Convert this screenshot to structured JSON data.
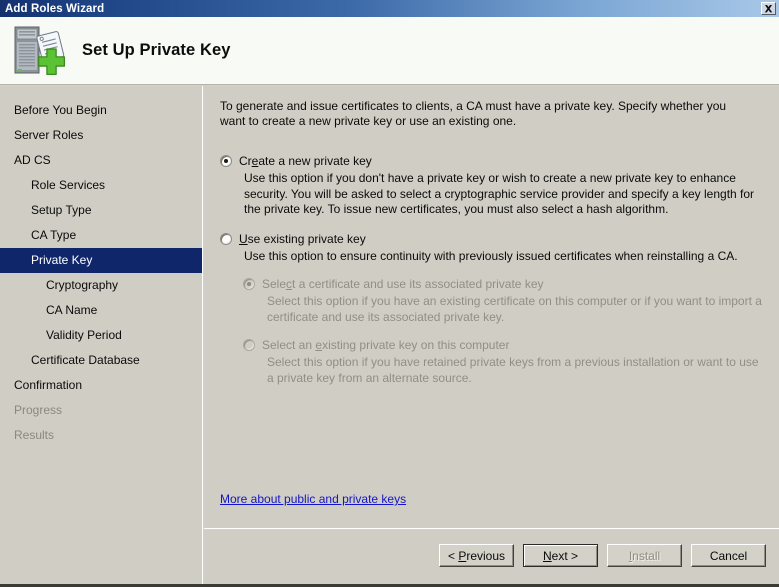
{
  "window": {
    "title": "Add Roles Wizard",
    "close_label": "Close",
    "close_icon": "close-icon"
  },
  "header": {
    "title": "Set Up Private Key",
    "icon": "server-certificate-add-icon"
  },
  "sidebar": {
    "items": [
      {
        "label": "Before You Begin",
        "level": 0,
        "state": "normal"
      },
      {
        "label": "Server Roles",
        "level": 0,
        "state": "normal"
      },
      {
        "label": "AD CS",
        "level": 0,
        "state": "normal"
      },
      {
        "label": "Role Services",
        "level": 1,
        "state": "normal"
      },
      {
        "label": "Setup Type",
        "level": 1,
        "state": "normal"
      },
      {
        "label": "CA Type",
        "level": 1,
        "state": "normal"
      },
      {
        "label": "Private Key",
        "level": 1,
        "state": "selected"
      },
      {
        "label": "Cryptography",
        "level": 2,
        "state": "normal"
      },
      {
        "label": "CA Name",
        "level": 2,
        "state": "normal"
      },
      {
        "label": "Validity Period",
        "level": 2,
        "state": "normal"
      },
      {
        "label": "Certificate Database",
        "level": 1,
        "state": "normal"
      },
      {
        "label": "Confirmation",
        "level": 0,
        "state": "normal"
      },
      {
        "label": "Progress",
        "level": 0,
        "state": "disabled"
      },
      {
        "label": "Results",
        "level": 0,
        "state": "disabled"
      }
    ]
  },
  "content": {
    "intro": "To generate and issue certificates to clients, a CA must have a private key. Specify whether you want to create a new private key or use an existing one.",
    "options": [
      {
        "label_pre": "Cr",
        "label_accel": "e",
        "label_post": "ate a new private key",
        "checked": true,
        "disabled": false,
        "description": "Use this option if you don't have a private key or wish to create a new private key to enhance security. You will be asked to select a cryptographic service provider and specify a key length for the private key. To issue new certificates, you must also select a hash algorithm."
      },
      {
        "label_pre": "",
        "label_accel": "U",
        "label_post": "se existing private key",
        "checked": false,
        "disabled": false,
        "description": "Use this option to ensure continuity with previously issued certificates when reinstalling a CA."
      }
    ],
    "sub_options": [
      {
        "label_pre": "Sele",
        "label_accel": "c",
        "label_post": "t a certificate and use its associated private key",
        "checked": true,
        "disabled": true,
        "description": "Select this option if you have an existing certificate on this computer or if you want to import a certificate and use its associated private key."
      },
      {
        "label_pre": "Select an ",
        "label_accel": "e",
        "label_post": "xisting private key on this computer",
        "checked": false,
        "disabled": true,
        "description": "Select this option if you have retained private keys from a previous installation or want to use a private key from an alternate source."
      }
    ],
    "help_link": "More about public and private keys"
  },
  "buttons": [
    {
      "pre": "< ",
      "accel": "P",
      "post": "revious",
      "state": "normal",
      "name": "previous-button"
    },
    {
      "pre": "",
      "accel": "N",
      "post": "ext >",
      "state": "default",
      "name": "next-button"
    },
    {
      "pre": "",
      "accel": "I",
      "post": "nstall",
      "state": "disabled",
      "name": "install-button"
    },
    {
      "pre": "",
      "accel": "",
      "post": "Cancel",
      "state": "normal",
      "name": "cancel-button"
    }
  ],
  "colors": {
    "title_bar_dark": "#14316e",
    "title_bar_light": "#a9c8e8",
    "selection": "#10266b",
    "face": "#d0cec4",
    "link": "#1414c8",
    "disabled_text": "#908e86"
  }
}
